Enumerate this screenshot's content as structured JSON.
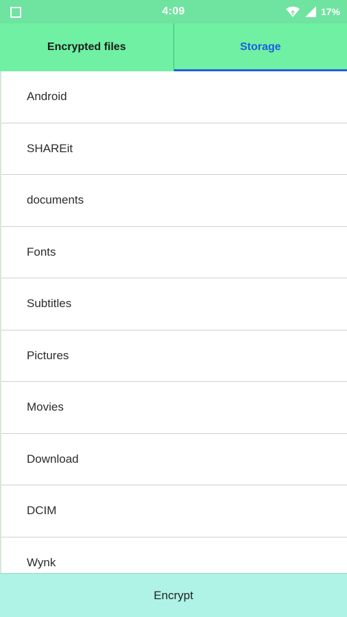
{
  "status_bar": {
    "time": "4:09",
    "battery": "17%",
    "icons": [
      "square-notification-icon",
      "wifi-icon",
      "signal-icon"
    ]
  },
  "tabs": [
    {
      "label": "Encrypted files",
      "active": false
    },
    {
      "label": "Storage",
      "active": true
    }
  ],
  "files": [
    "Android",
    "SHAREit",
    "documents",
    "Fonts",
    "Subtitles",
    "Pictures",
    "Movies",
    "Download",
    "DCIM",
    "Wynk"
  ],
  "actions": {
    "encrypt_label": "Encrypt"
  },
  "colors": {
    "status_bar": "#6fe3a0",
    "tab_bar": "#6ff0a3",
    "active_tab": "#1b5fe0",
    "encrypt_button": "#aef3e6"
  }
}
